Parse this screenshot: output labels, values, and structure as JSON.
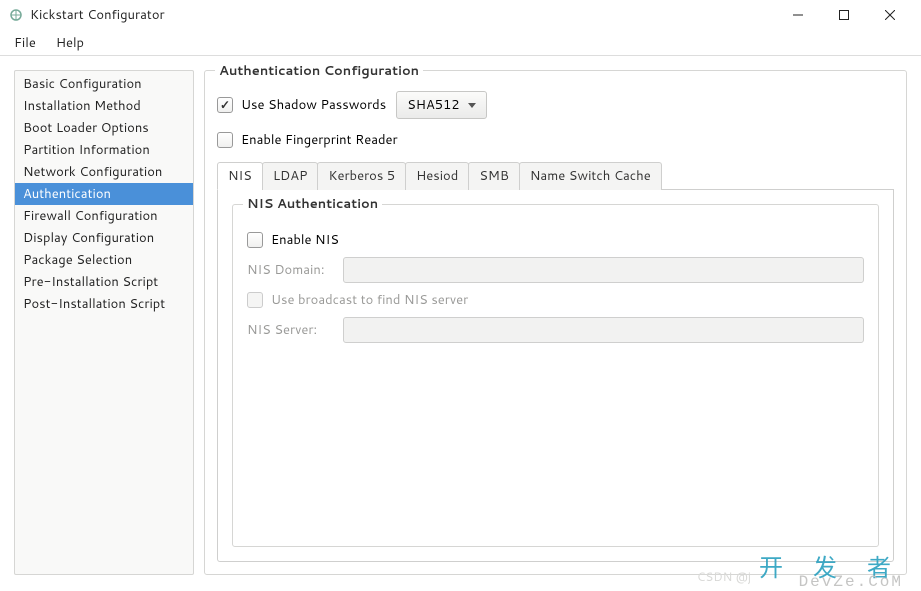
{
  "window": {
    "title": "Kickstart Configurator"
  },
  "menu": {
    "file": "File",
    "help": "Help"
  },
  "sidebar": {
    "items": [
      "Basic Configuration",
      "Installation Method",
      "Boot Loader Options",
      "Partition Information",
      "Network Configuration",
      "Authentication",
      "Firewall Configuration",
      "Display Configuration",
      "Package Selection",
      "Pre-Installation Script",
      "Post-Installation Script"
    ],
    "selected_index": 5
  },
  "content": {
    "group_title": "Authentication Configuration",
    "use_shadow": {
      "label": "Use Shadow Passwords",
      "checked": true
    },
    "hash_dropdown": {
      "value": "SHA512"
    },
    "enable_fingerprint": {
      "label": "Enable Fingerprint Reader",
      "checked": false
    },
    "tabs": [
      "NIS",
      "LDAP",
      "Kerberos 5",
      "Hesiod",
      "SMB",
      "Name Switch Cache"
    ],
    "active_tab": 0,
    "nis": {
      "group_title": "NIS Authentication",
      "enable_nis": {
        "label": "Enable NIS",
        "checked": false
      },
      "domain_label": "NIS Domain:",
      "domain_value": "",
      "use_broadcast": {
        "label": "Use broadcast to find NIS server",
        "checked": false,
        "disabled": true
      },
      "server_label": "NIS Server:",
      "server_value": ""
    }
  },
  "watermark": {
    "big": "开 发 者",
    "small": "DevZe.CoM",
    "csdn": "CSDN @j"
  }
}
